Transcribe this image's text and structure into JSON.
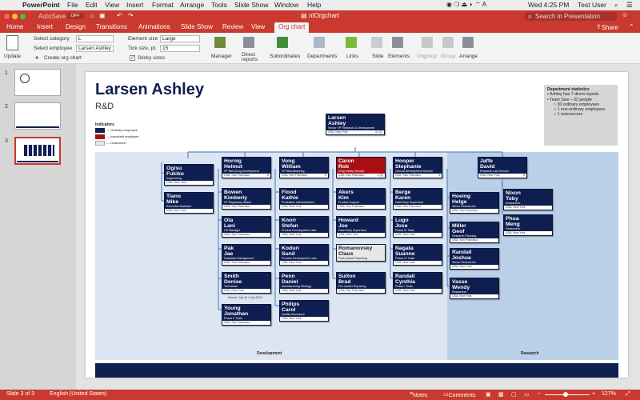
{
  "menubar": {
    "app": "PowerPoint",
    "items": [
      "File",
      "Edit",
      "View",
      "Insert",
      "Format",
      "Arrange",
      "Tools",
      "Slide Show",
      "Window",
      "Help"
    ],
    "clock": "Wed 4:25 PM",
    "user": "Test User"
  },
  "titlebar": {
    "autosave": "AutoSave",
    "autosave_state": "OFF",
    "doc_title": "ntOrgchart",
    "search_placeholder": "Search in Presentation",
    "share": "Share"
  },
  "tabs": [
    "Home",
    "Insert",
    "Design",
    "Transitions",
    "Animations",
    "Slide Show",
    "Review",
    "View",
    "Org chart"
  ],
  "ribbon": {
    "update": "Update",
    "select_category_label": "Select category",
    "select_category_value": "L",
    "select_employee_label": "Select employee",
    "select_employee_value": "Larsen Ashley",
    "create_org_chart": "Create org chart",
    "element_size_label": "Element size",
    "element_size_value": "Large",
    "tick_size_label": "Tick size, pt.",
    "tick_size_value": "15",
    "sticky_sizes": "Sticky sizes",
    "sticky_checked": true,
    "buttons": [
      "Manager",
      "Direct reports",
      "Subordinates",
      "Departments",
      "Links",
      "Slide",
      "Elements",
      "Ungroup",
      "Group",
      "Arrange"
    ]
  },
  "thumbs": [
    "1",
    "2",
    "3"
  ],
  "slide": {
    "title": "Larsen Ashley",
    "subtitle": "R&D",
    "legend": {
      "title": "Indicators",
      "items": [
        "— Ordinary employee",
        "— Important employee",
        "— Outsourcer"
      ]
    },
    "stats": {
      "title": "Department statistics",
      "lines": [
        "Ashley has 7 direct reports",
        "Team Size – 32 people"
      ],
      "sub": [
        "30 ordinary employees",
        "1 non-ordinary employees",
        "1 outsourcers"
      ]
    },
    "dept_development": "Development",
    "dept_research": "Research",
    "date_note": "Moved: July 18 / July 2019",
    "root": {
      "name": "Larsen\nAshley",
      "title": "Senior VP Research & Development",
      "loc": "USA, New York",
      "count": "32 (1)"
    },
    "cards": [
      {
        "id": "ogisu",
        "name": "Ogisu\nFukiko",
        "title": "Engineering",
        "loc": "USA, New York",
        "type": "ord"
      },
      {
        "id": "tiano",
        "name": "Tiano\nMike",
        "title": "Executive Assistant",
        "loc": "USA, New York",
        "type": "ord"
      },
      {
        "id": "hornig",
        "name": "Hornig\nHelmut",
        "title": "VP New Drug Development",
        "loc": "USA, San Francisco",
        "count": "6",
        "type": "ord"
      },
      {
        "id": "bowen",
        "name": "Bowen\nKimberly",
        "title": "VP Regulatory Affairs",
        "loc": "USA, San Francisco",
        "type": "ord"
      },
      {
        "id": "ota",
        "name": "Ota\nLani",
        "title": "HS Manager",
        "loc": "USA, San Francisco",
        "type": "ord"
      },
      {
        "id": "pak",
        "name": "Pak\nJae",
        "title": "Database Management",
        "loc": "USA, San Francisco",
        "type": "ord"
      },
      {
        "id": "smith",
        "name": "Smith\nDenise",
        "title": "Technician",
        "loc": "USA, New York",
        "type": "ord"
      },
      {
        "id": "young",
        "name": "Young\nJonathan",
        "title": "Phase II Trials",
        "loc": "USA, San Francisco",
        "type": "ord"
      },
      {
        "id": "vong",
        "name": "Vong\nWilliam",
        "title": "VP Manufacturing",
        "loc": "USA, San Francisco",
        "count": "5",
        "type": "ord"
      },
      {
        "id": "flood",
        "name": "Flood\nKathie",
        "title": "Production Administration",
        "loc": "USA, New York",
        "type": "ord"
      },
      {
        "id": "knorr",
        "name": "Knorr\nStefan",
        "title": "Product Development Labs",
        "loc": "USA, New York",
        "type": "ord"
      },
      {
        "id": "koduri",
        "name": "Koduri\nSunil",
        "title": "Process Development Labs",
        "loc": "USA, New York",
        "type": "ord"
      },
      {
        "id": "penn",
        "name": "Penn\nDaniel",
        "title": "Manufacturing Strategy",
        "loc": "USA, New York",
        "type": "ord"
      },
      {
        "id": "philips",
        "name": "Philips\nCarol",
        "title": "Quality Assurance",
        "loc": "USA, New York",
        "type": "ord"
      },
      {
        "id": "caron",
        "name": "Caron\nRob",
        "title": "Drug Safety Director",
        "loc": "USA, San Francisco",
        "count": "4 (1)",
        "type": "imp"
      },
      {
        "id": "akers",
        "name": "Akers\nKim",
        "title": "Product Support",
        "loc": "USA, San Francisco",
        "type": "ord"
      },
      {
        "id": "howard",
        "name": "Howard\nJoe",
        "title": "Data Entry Supervisor",
        "loc": "USA, New York",
        "type": "ord"
      },
      {
        "id": "romanovsky",
        "name": "Romanovsky\nClaus",
        "title": "Post-market Reporting",
        "loc": "",
        "type": "out"
      },
      {
        "id": "sutton",
        "name": "Sutton\nBrad",
        "title": "Pre-market Reporting",
        "loc": "USA, San Francisco",
        "type": "ord"
      },
      {
        "id": "hooper",
        "name": "Hooper\nStephanie",
        "title": "Clinical Development Director",
        "loc": "USA, San Francisco",
        "count": "4",
        "type": "ord"
      },
      {
        "id": "berge",
        "name": "Berge\nKaren",
        "title": "Data Entry Supervisor",
        "loc": "USA, San Francisco",
        "type": "ord"
      },
      {
        "id": "lugo",
        "name": "Lugo\nJose",
        "title": "Phase III Trials",
        "loc": "USA, New York",
        "type": "ord"
      },
      {
        "id": "nagata",
        "name": "Nagata\nSuanne",
        "title": "Phase IV Trials",
        "loc": "USA, New York",
        "type": "ord"
      },
      {
        "id": "randall_c",
        "name": "Randall\nCynthia",
        "title": "Phase I Trials",
        "loc": "USA, New York",
        "type": "ord"
      },
      {
        "id": "jaffe",
        "name": "Jaffe\nDavid",
        "title": "Research Lab Director",
        "loc": "USA, New York",
        "count": "8",
        "type": "ord"
      },
      {
        "id": "hoeing",
        "name": "Hoeing\nHelge",
        "title": "Senior Researcher",
        "loc": "USA, San Francisco",
        "type": "ord"
      },
      {
        "id": "miller",
        "name": "Miller\nGeof",
        "title": "Research Planning",
        "loc": "USA, San Francisco",
        "type": "ord"
      },
      {
        "id": "randall_j",
        "name": "Randall\nJoshua",
        "title": "Senior Researcher",
        "loc": "USA, New York",
        "type": "ord"
      },
      {
        "id": "vasse",
        "name": "Vasse\nWendy",
        "title": "Researcher",
        "loc": "USA, New York",
        "type": "ord"
      },
      {
        "id": "nixon",
        "name": "Nixon\nToby",
        "title": "Researcher",
        "loc": "USA, New York",
        "type": "ord"
      },
      {
        "id": "phua",
        "name": "Phua\nMeng",
        "title": "Researcher",
        "loc": "USA, New York",
        "type": "ord"
      }
    ]
  },
  "status": {
    "slide": "Slide 3 of 3",
    "language": "English (United States)",
    "notes": "Notes",
    "comments": "Comments",
    "zoom": "127%"
  }
}
